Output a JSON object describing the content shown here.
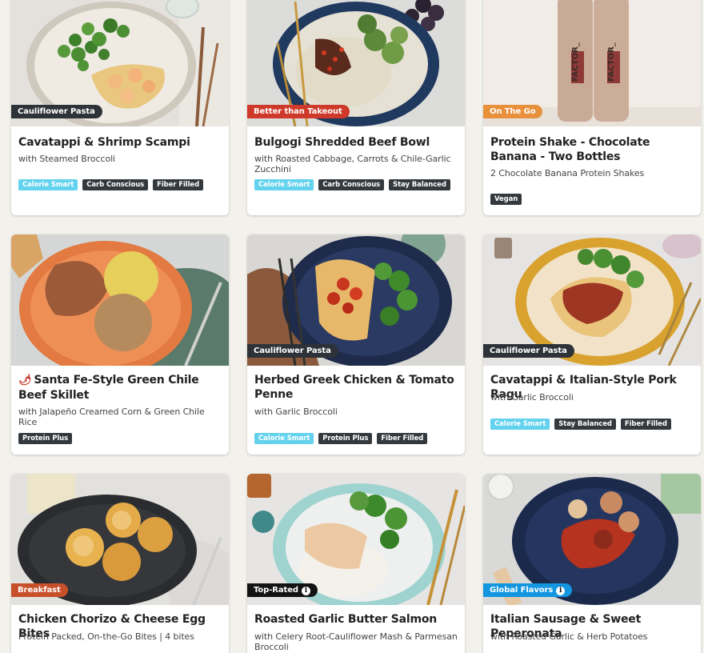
{
  "colors": {
    "cauliflower_pasta": "#2d3338",
    "better_than_takeout": "#cf3929",
    "on_the_go": "#e8903c",
    "breakfast": "#c7502a",
    "top_rated": "#131313",
    "global_flavors": "#1296e0",
    "tag_light": "#63d2ee",
    "tag_dark": "#34393d"
  },
  "meals": [
    {
      "badge": "Cauliflower Pasta",
      "title": "Cavatappi & Shrimp Scampi",
      "subtitle": "with Steamed Broccoli",
      "tags": [
        "Calorie Smart",
        "Carb Conscious",
        "Fiber Filled"
      ]
    },
    {
      "badge": "Better than Takeout",
      "title": "Bulgogi Shredded Beef Bowl",
      "subtitle": "with Roasted Cabbage, Carrots & Chile-Garlic Zucchini",
      "tags": [
        "Calorie Smart",
        "Carb Conscious",
        "Stay Balanced"
      ]
    },
    {
      "badge": "On The Go",
      "title": "Protein Shake - Chocolate Banana - Two Bottles",
      "subtitle": "2 Chocolate Banana Protein Shakes",
      "tags": [
        "Vegan"
      ],
      "bottle_brand": "FACTOR_",
      "bottle_label": "PROTEIN SHAKE"
    },
    {
      "badge": "",
      "icon": "chili-pepper-icon",
      "title": "Santa Fe-Style Green Chile Beef Skillet",
      "subtitle": "with Jalapeño Creamed Corn & Green Chile Rice",
      "tags": [
        "Protein Plus"
      ]
    },
    {
      "badge": "Cauliflower Pasta",
      "title": "Herbed Greek Chicken & Tomato Penne",
      "subtitle": "with Garlic Broccoli",
      "tags": [
        "Calorie Smart",
        "Protein Plus",
        "Fiber Filled"
      ]
    },
    {
      "badge": "Cauliflower Pasta",
      "title": "Cavatappi & Italian-Style Pork Ragu",
      "subtitle": "with Garlic Broccoli",
      "tags": [
        "Calorie Smart",
        "Stay Balanced",
        "Fiber Filled"
      ]
    },
    {
      "badge": "Breakfast",
      "title": "Chicken Chorizo & Cheese Egg Bites",
      "subtitle": "Protein Packed, On-the-Go Bites | 4 bites",
      "tags": []
    },
    {
      "badge": "Top-Rated",
      "badge_icon": "info-icon",
      "title": "Roasted Garlic Butter Salmon",
      "subtitle": "with Celery Root-Cauliflower Mash & Parmesan Broccoli",
      "tags": []
    },
    {
      "badge": "Global Flavors",
      "badge_icon": "info-icon",
      "title": "Italian Sausage & Sweet Peperonata",
      "subtitle": "with Roasted Garlic & Herb Potatoes",
      "tags": []
    }
  ]
}
